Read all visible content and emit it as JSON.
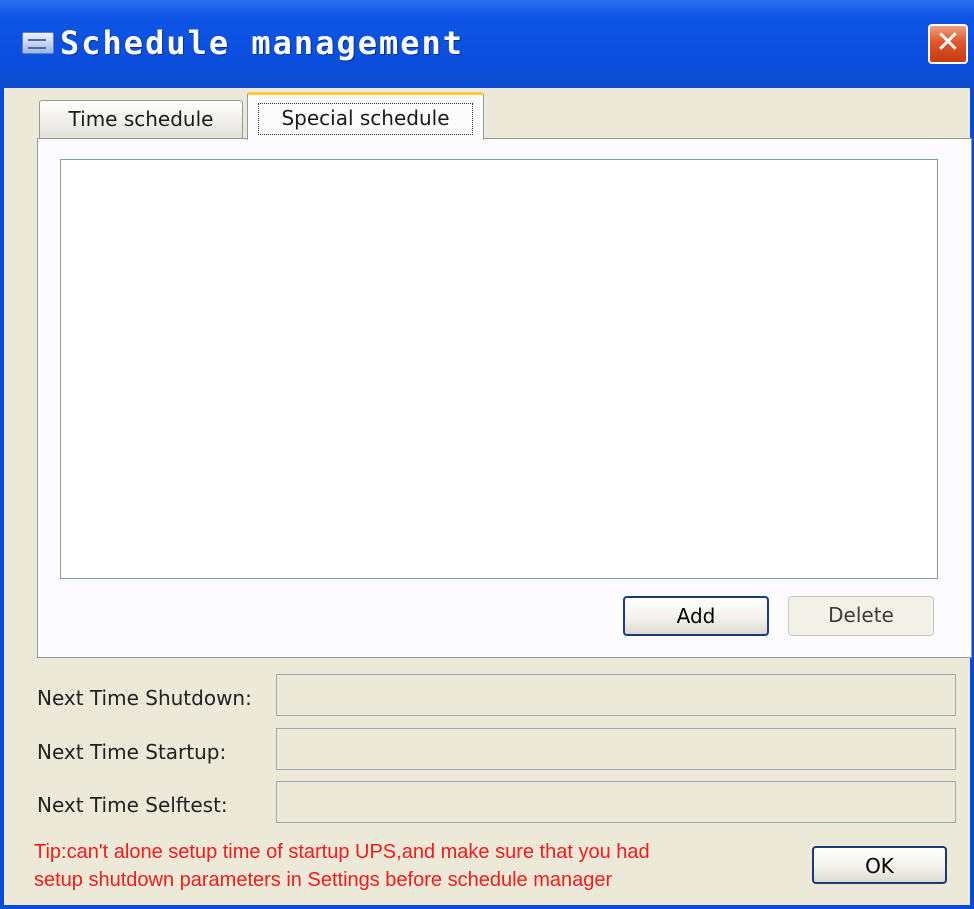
{
  "window": {
    "title": "Schedule management",
    "close_label": "✕"
  },
  "tabs": [
    {
      "label": "Time schedule",
      "active": false
    },
    {
      "label": "Special schedule",
      "active": true
    }
  ],
  "panel": {
    "add_label": "Add",
    "delete_label": "Delete"
  },
  "fields": [
    {
      "label": "Next Time Shutdown:",
      "value": ""
    },
    {
      "label": "Next Time Startup:",
      "value": ""
    },
    {
      "label": "Next Time Selftest:",
      "value": ""
    }
  ],
  "tip": {
    "line1": "Tip:can't alone setup time of startup UPS,and make sure that you had",
    "line2": "setup shutdown parameters in Settings before schedule manager"
  },
  "ok_label": "OK",
  "colors": {
    "titlebar": "#0a4fe0",
    "client": "#ece9d8",
    "tip_text": "#ff1a1a",
    "active_tab_accent": "#ffc83c"
  }
}
